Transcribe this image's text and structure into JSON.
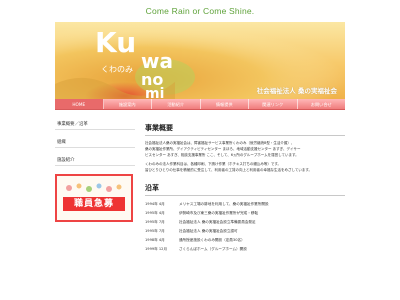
{
  "header": {
    "tagline": "Come Rain or Come Shine.",
    "logo_text": "Kuwanomi",
    "logo_hiragana": "くわのみ",
    "corporation": "社会福祉法人 桑の実福祉会"
  },
  "nav": {
    "items": [
      {
        "label": "HOME"
      },
      {
        "label": "施設案内"
      },
      {
        "label": "活動紹介"
      },
      {
        "label": "情報提供"
      },
      {
        "label": "関連リンク"
      },
      {
        "label": "お問い合せ"
      }
    ]
  },
  "sidebar": {
    "items": [
      {
        "label": "事業概要／沿革"
      },
      {
        "label": "組織"
      },
      {
        "label": "施設紹介"
      }
    ],
    "recruit_banner": "職員急募"
  },
  "main": {
    "overview_title": "事業概要",
    "paragraphs": [
      "社会福祉法人桑の実福祉会は、障害福祉サービス事業所くわのみ（就労継続B型・生活介護）、",
      "桑の実福祉作業所、デイアクティビティセンター まほろ、地域活動支援センター あすぎ、デイサー",
      "ビスセンター あすぎ、相談支援事業所 ここ、そして、6ヵ所のグループホームを運営しています。",
      "くわのみの法人作業科目は、各種印刷、下請け作業（ホチキス打ちの綴込み等）です。",
      "皆ひとりひとりの仕事を積極的に受注して、利用者の工賃の向上と利用者の幸福な生活をめざしています。"
    ],
    "history_title": "沿革",
    "history": [
      {
        "date": "1994年 4月",
        "event": "メリヤス工場の跡地を利用して、桑の実福祉作業所開設"
      },
      {
        "date": "1995年 4月",
        "event": "伊勢崎市及び東三桑の実福祉作業所が完成・移転"
      },
      {
        "date": "1995年 7月",
        "event": "社会福祉法人 桑の実福祉会設立準備委員会発足"
      },
      {
        "date": "1995年 7月",
        "event": "社会福祉法人 桑の実福祉会設立認可"
      },
      {
        "date": "1998年 4月",
        "event": "通所授産施設くわのみ開設（定員30名）"
      },
      {
        "date": "1999年 12月",
        "event": "さくらんぼホーム（グループホーム）開設"
      }
    ]
  },
  "colors": {
    "accent_green": "#5fa23a",
    "nav_pink": "#f07c7c",
    "recruit_red": "#e33333"
  }
}
